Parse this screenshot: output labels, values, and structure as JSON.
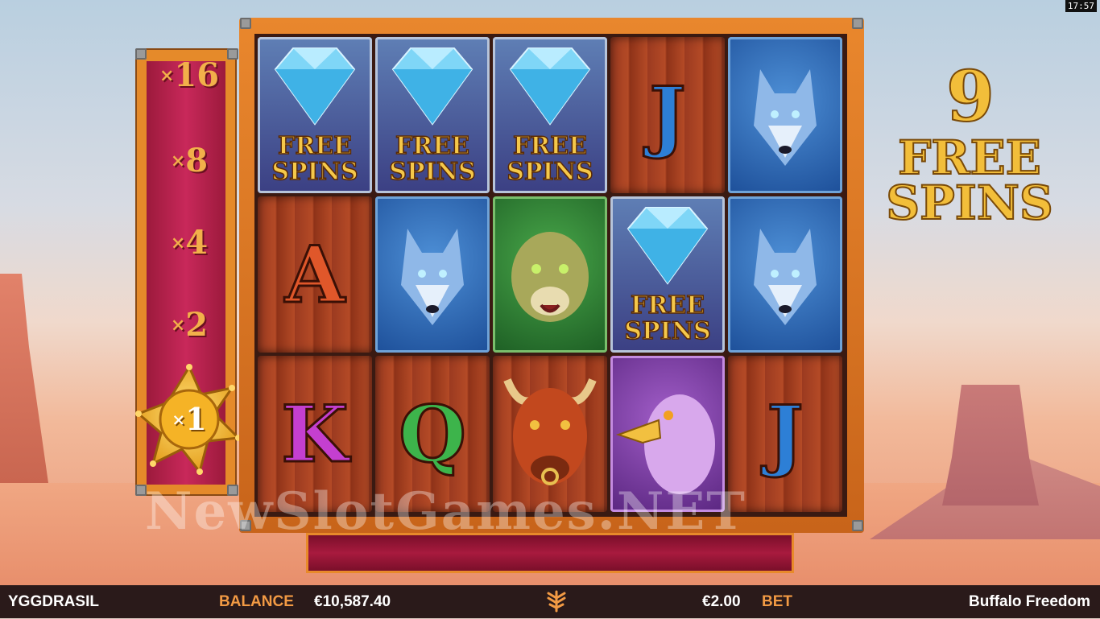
{
  "clock": "17:57",
  "multipliers": [
    {
      "prefix": "×",
      "value": "16"
    },
    {
      "prefix": "×",
      "value": "8"
    },
    {
      "prefix": "×",
      "value": "4"
    },
    {
      "prefix": "×",
      "value": "2"
    }
  ],
  "active_multiplier": {
    "prefix": "×",
    "value": "1"
  },
  "reels": [
    [
      {
        "symbol": "diamond-free-spins",
        "line1": "FREE",
        "line2": "SPINS"
      },
      {
        "symbol": "letter",
        "label": "A",
        "color": "a"
      },
      {
        "symbol": "letter",
        "label": "K",
        "color": "k"
      }
    ],
    [
      {
        "symbol": "diamond-free-spins",
        "line1": "FREE",
        "line2": "SPINS"
      },
      {
        "symbol": "wolf"
      },
      {
        "symbol": "letter",
        "label": "Q",
        "color": "q"
      }
    ],
    [
      {
        "symbol": "diamond-free-spins",
        "line1": "FREE",
        "line2": "SPINS"
      },
      {
        "symbol": "cougar"
      },
      {
        "symbol": "buffalo"
      }
    ],
    [
      {
        "symbol": "letter",
        "label": "J",
        "color": "j"
      },
      {
        "symbol": "diamond-free-spins",
        "line1": "FREE",
        "line2": "SPINS"
      },
      {
        "symbol": "eagle"
      }
    ],
    [
      {
        "symbol": "wolf"
      },
      {
        "symbol": "wolf"
      },
      {
        "symbol": "letter",
        "label": "J",
        "color": "j"
      }
    ]
  ],
  "free_spins": {
    "count": "9",
    "line1": "FREE",
    "line2": "SPINS"
  },
  "watermark": "NewSlotGames.NET",
  "bottom": {
    "brand": "YGGDRASIL",
    "balance_label": "BALANCE",
    "balance_value": "€10,587.40",
    "bet_value": "€2.00",
    "bet_label": "BET",
    "game_title": "Buffalo Freedom"
  }
}
